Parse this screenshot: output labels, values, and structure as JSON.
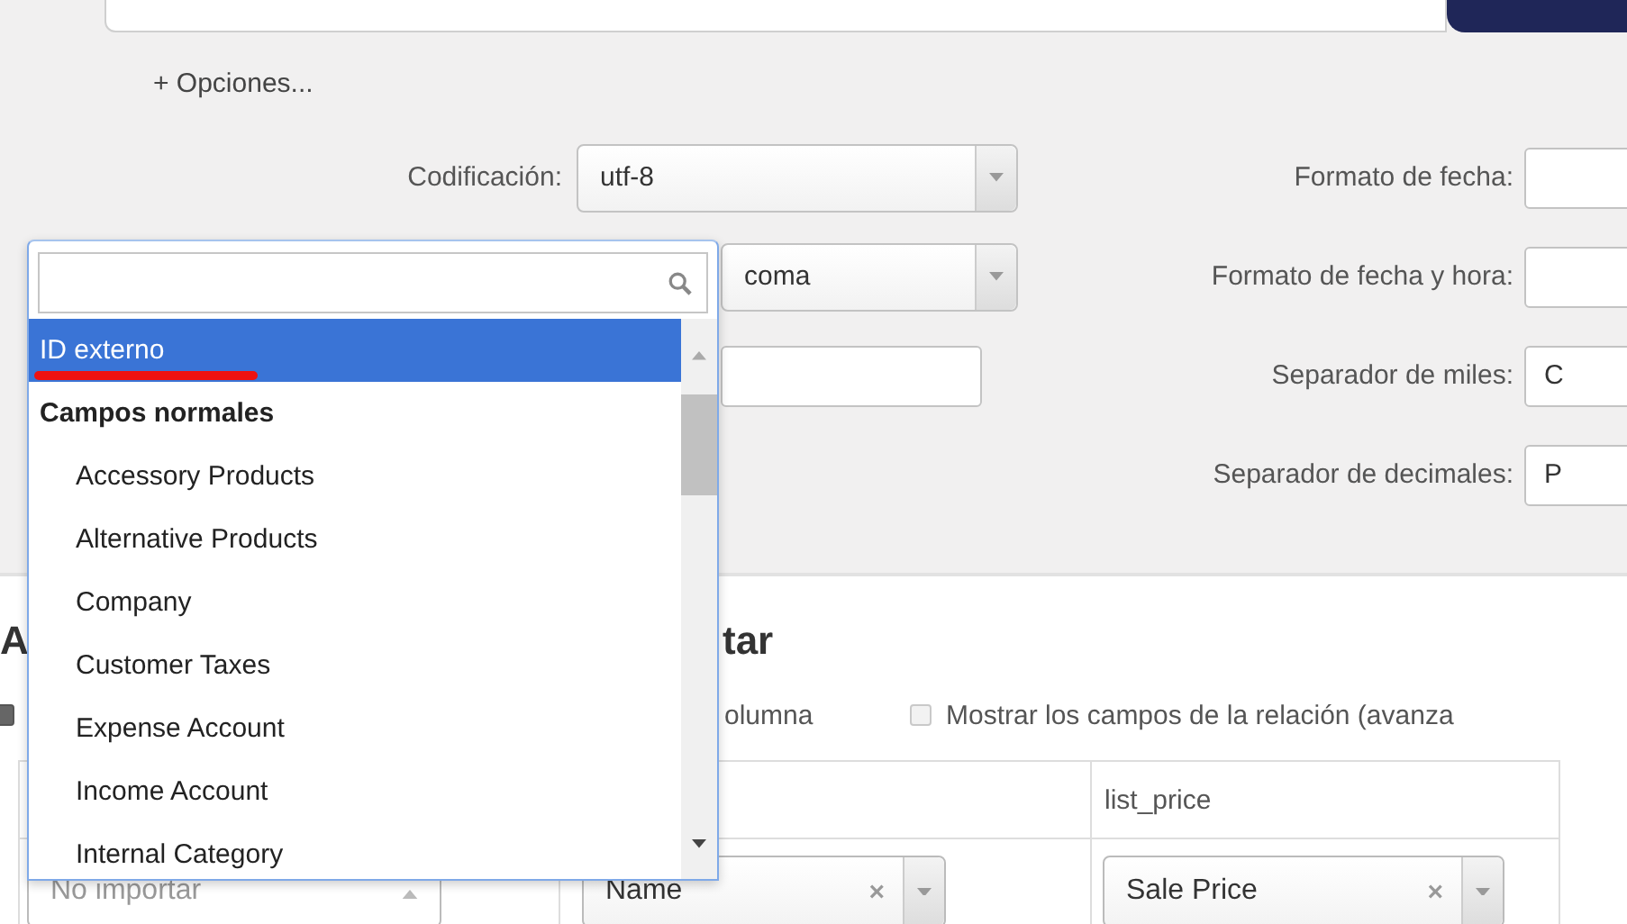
{
  "options_link": "+ Opciones...",
  "fields_left": [
    {
      "kind": "select",
      "label": "Codificación:",
      "value": "utf-8"
    },
    {
      "kind": "select",
      "value": "coma"
    },
    {
      "kind": "input"
    }
  ],
  "fields_right": [
    {
      "label": "Formato de fecha:"
    },
    {
      "label": "Formato de fecha y hora:"
    },
    {
      "label": "Separador de miles:",
      "value": "C"
    },
    {
      "label": "Separador de decimales:",
      "value": "P"
    }
  ],
  "heading_parts": [
    "A",
    "tar"
  ],
  "checkboxes": [
    {
      "label": "olumna",
      "checked": true
    },
    {
      "label": "Mostrar los campos de la relación (avanza",
      "checked": false
    }
  ],
  "table": {
    "columns": [
      {},
      {},
      {
        "header": "list_price"
      }
    ],
    "mapping": [
      {
        "placeholder": "No importar",
        "open": true
      },
      {
        "value": "Name",
        "clear": "×",
        "open": false
      },
      {
        "value": "Sale Price",
        "clear": "×",
        "open": false
      }
    ]
  },
  "dropdown": {
    "items": [
      {
        "kind": "option",
        "label": "ID externo",
        "selected": true
      },
      {
        "kind": "group",
        "label": "Campos normales",
        "children": [
          {
            "label": "Accessory Products",
            "selected": false
          },
          {
            "label": "Alternative Products",
            "selected": false
          },
          {
            "label": "Company",
            "selected": false
          },
          {
            "label": "Customer Taxes",
            "selected": false
          },
          {
            "label": "Expense Account",
            "selected": false
          },
          {
            "label": "Income Account",
            "selected": false
          },
          {
            "label": "Internal Category",
            "selected": false
          }
        ]
      }
    ]
  }
}
